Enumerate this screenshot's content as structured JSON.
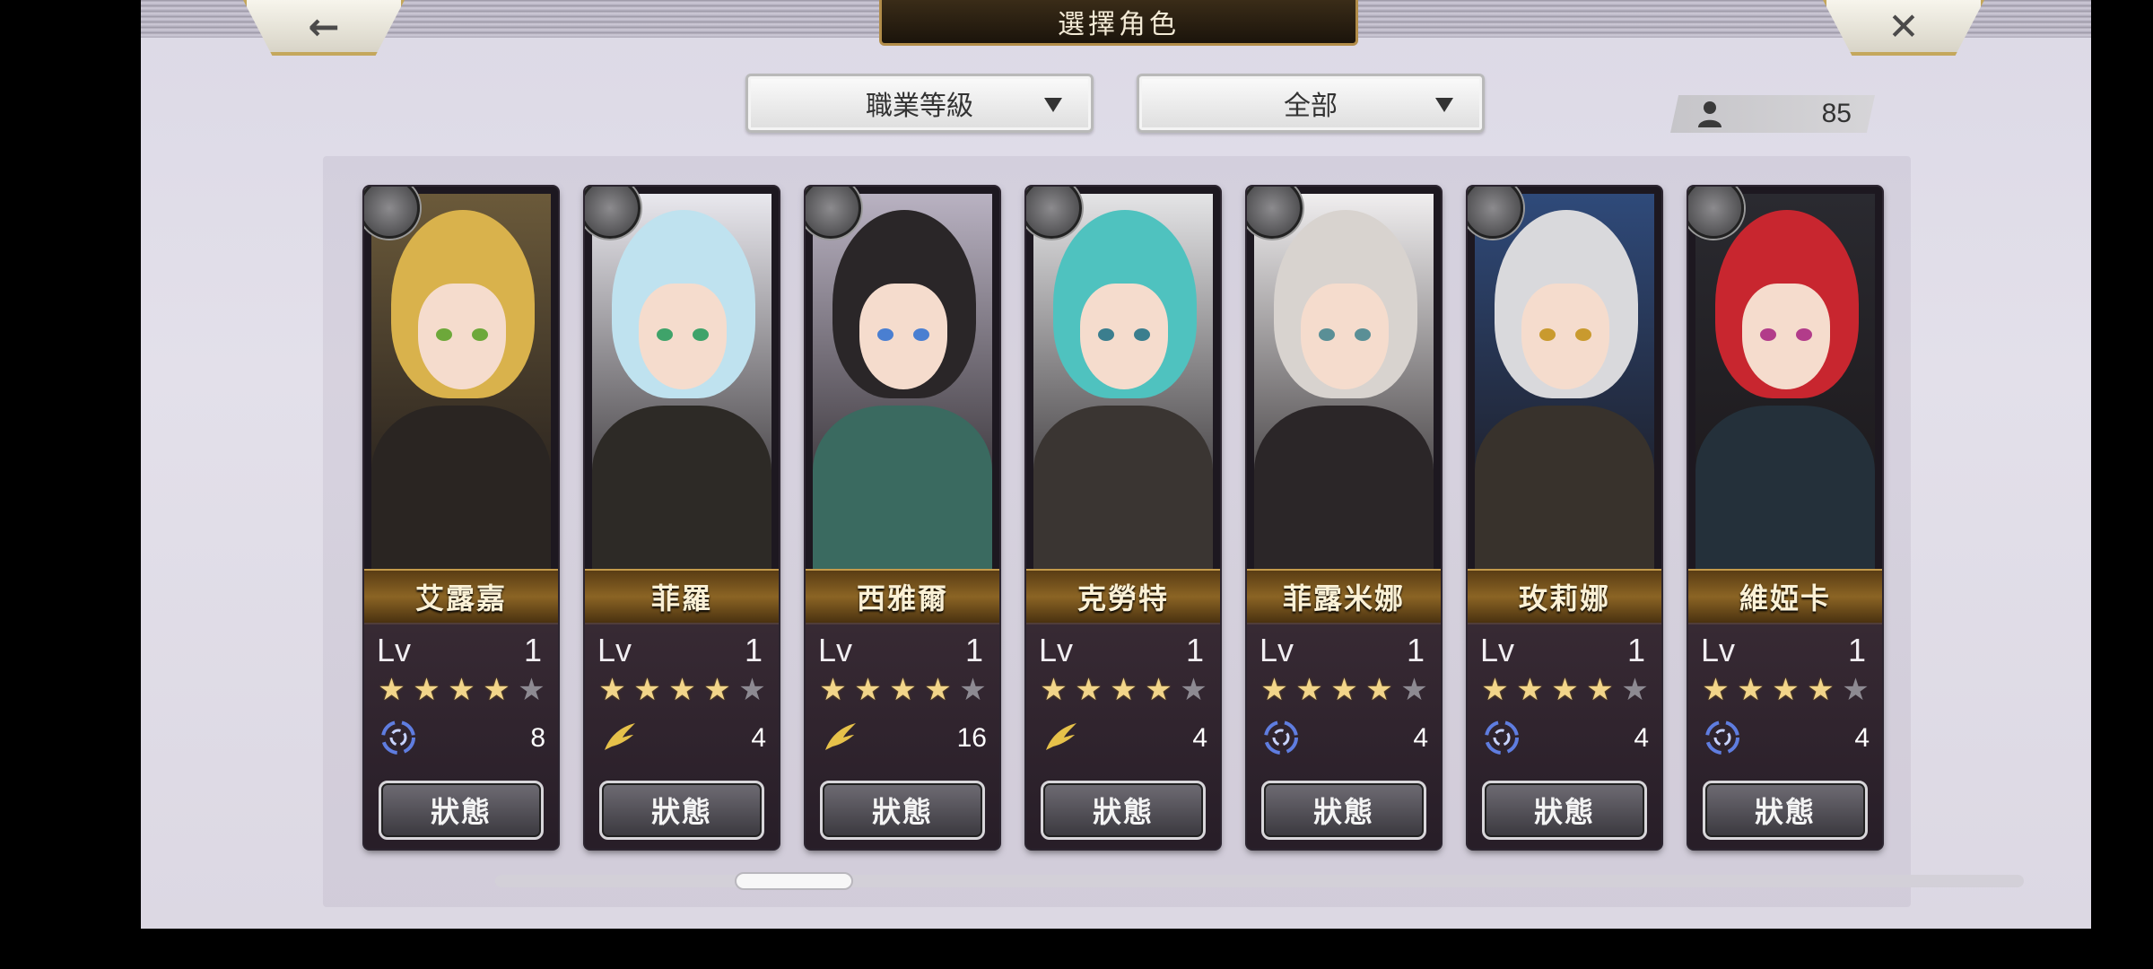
{
  "header": {
    "title": "選擇角色",
    "back_icon": "←",
    "close_icon": "✕"
  },
  "filters": {
    "job_level": {
      "label": "職業等級"
    },
    "category": {
      "label": "全部"
    }
  },
  "party_count": {
    "value": "85"
  },
  "card_action_label": "狀態",
  "characters": [
    {
      "name": "艾露嘉",
      "lv_label": "Lv",
      "level": "1",
      "stars": 4,
      "max_stars": 5,
      "element": "vortex",
      "element_value": "8",
      "class_icon": "sword-icon"
    },
    {
      "name": "菲羅",
      "lv_label": "Lv",
      "level": "1",
      "stars": 4,
      "max_stars": 5,
      "element": "wing",
      "element_value": "4",
      "class_icon": "axe-icon"
    },
    {
      "name": "西雅爾",
      "lv_label": "Lv",
      "level": "1",
      "stars": 4,
      "max_stars": 5,
      "element": "wing",
      "element_value": "16",
      "class_icon": "bow-icon"
    },
    {
      "name": "克勞特",
      "lv_label": "Lv",
      "level": "1",
      "stars": 4,
      "max_stars": 5,
      "element": "wing",
      "element_value": "4",
      "class_icon": "bow-icon"
    },
    {
      "name": "菲露米娜",
      "lv_label": "Lv",
      "level": "1",
      "stars": 4,
      "max_stars": 5,
      "element": "vortex",
      "element_value": "4",
      "class_icon": "fist-icon"
    },
    {
      "name": "玫莉娜",
      "lv_label": "Lv",
      "level": "1",
      "stars": 4,
      "max_stars": 5,
      "element": "vortex",
      "element_value": "4",
      "class_icon": "hammer-icon"
    },
    {
      "name": "維婭卡",
      "lv_label": "Lv",
      "level": "1",
      "stars": 4,
      "max_stars": 5,
      "element": "vortex",
      "element_value": "4",
      "class_icon": "hammer-icon"
    }
  ],
  "scroll": {
    "position_fraction": 0.17
  },
  "colors": {
    "star_on": "#f2d58a",
    "star_off": "#8d8a92",
    "name_plate": "#8b6424",
    "element_vortex": "#5f7de0",
    "element_wing": "#e6c14a"
  }
}
